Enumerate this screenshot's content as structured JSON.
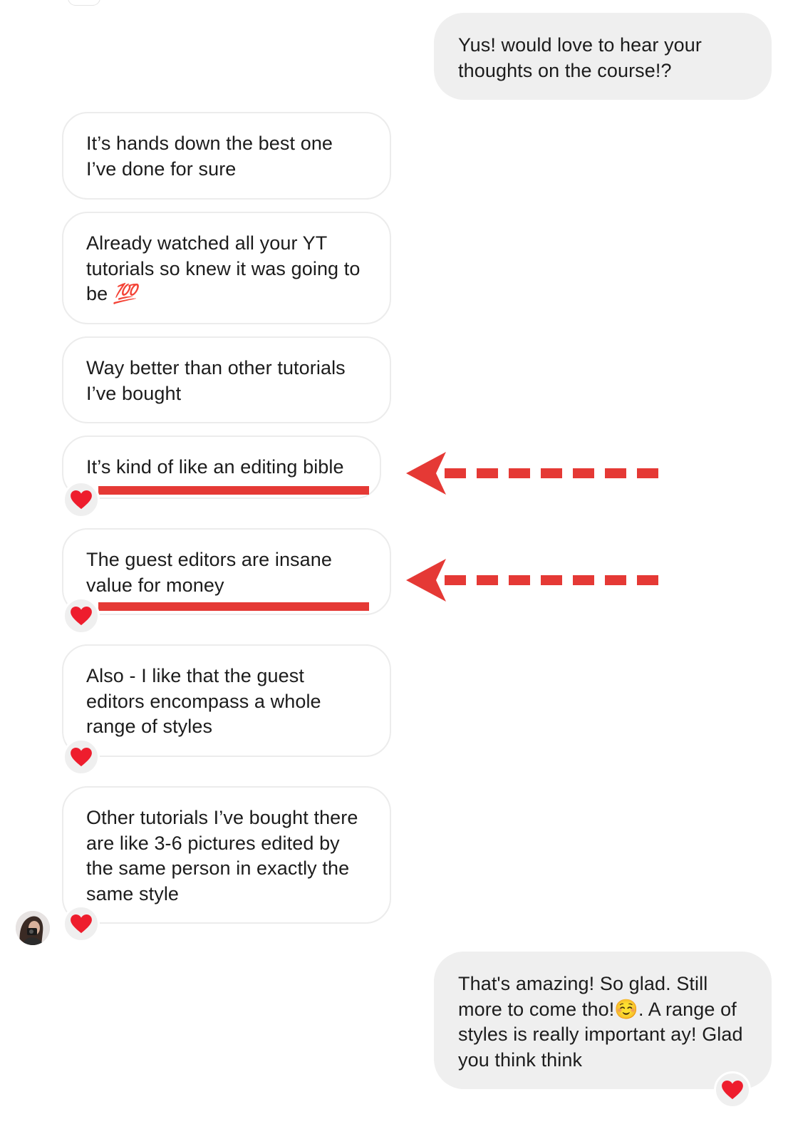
{
  "messages": [
    {
      "id": "m1",
      "side": "outgoing",
      "text": "Yus! would love to hear your thoughts on the course!?",
      "reaction": null
    },
    {
      "id": "m2",
      "side": "incoming",
      "text": "It’s hands down the best one I’ve done for sure",
      "reaction": null
    },
    {
      "id": "m3",
      "side": "incoming",
      "text": "Already watched all your YT tutorials so knew it was going to be",
      "emoji": "💯",
      "reaction": null
    },
    {
      "id": "m4",
      "side": "incoming",
      "text": "Way better than other tutorials I’ve bought",
      "reaction": null
    },
    {
      "id": "m5",
      "side": "incoming",
      "text": "It’s kind of like an editing bible",
      "reaction": "❤️",
      "annotated": true
    },
    {
      "id": "m6",
      "side": "incoming",
      "text": "The guest editors are insane value for money",
      "reaction": "❤️",
      "annotated": true
    },
    {
      "id": "m7",
      "side": "incoming",
      "text": "Also - I like that the guest editors encompass a whole range of styles",
      "reaction": "❤️"
    },
    {
      "id": "m8",
      "side": "incoming",
      "text": "Other tutorials I’ve bought there are like 3-6 pictures edited by the same person in exactly the same style",
      "reaction": "❤️"
    },
    {
      "id": "m9",
      "side": "outgoing",
      "text_before": "That's amazing! So glad. Still more to come tho!",
      "emoji": "☺️",
      "text_after": ". A range of styles is really important ay! Glad you think think",
      "reaction": "❤️"
    }
  ],
  "colors": {
    "annotation_red": "#e53935",
    "heart_red": "#ee1d2d",
    "outgoing_bubble": "#efefef",
    "incoming_border": "#ececec"
  },
  "icons": {
    "reaction": "heart-icon",
    "annotation": "red-dashed-arrow"
  }
}
